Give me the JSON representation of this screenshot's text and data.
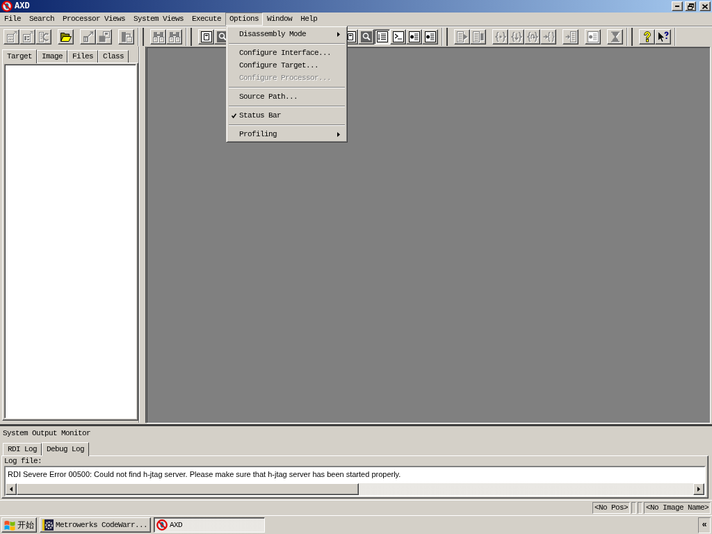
{
  "window": {
    "title": "AXD"
  },
  "menu_bar": [
    {
      "label": "File",
      "open": false
    },
    {
      "label": "Search",
      "open": false
    },
    {
      "label": "Processor Views",
      "open": false
    },
    {
      "label": "System Views",
      "open": false
    },
    {
      "label": "Execute",
      "open": false
    },
    {
      "label": "Options",
      "open": true,
      "groups": [
        [
          {
            "label": "Disassembly Mode",
            "submenu": true,
            "checked": false,
            "disabled": false
          }
        ],
        [
          {
            "label": "Configure Interface...",
            "submenu": false,
            "checked": false,
            "disabled": false
          },
          {
            "label": "Configure Target...",
            "submenu": false,
            "checked": false,
            "disabled": false
          },
          {
            "label": "Configure Processor...",
            "submenu": false,
            "checked": false,
            "disabled": true
          }
        ],
        [
          {
            "label": "Source Path...",
            "submenu": false,
            "checked": false,
            "disabled": false
          }
        ],
        [
          {
            "label": "Status Bar",
            "submenu": false,
            "checked": true,
            "disabled": false
          }
        ],
        [
          {
            "label": "Profiling",
            "submenu": true,
            "checked": false,
            "disabled": false
          }
        ]
      ]
    },
    {
      "label": "Window",
      "open": false
    },
    {
      "label": "Help",
      "open": false
    }
  ],
  "toolbars": [
    {
      "runs": [
        [
          {
            "kind": "binary",
            "disabled": true,
            "pressed": false
          },
          {
            "kind": "symbols",
            "disabled": true,
            "pressed": false
          },
          {
            "kind": "reload",
            "disabled": true,
            "pressed": false
          }
        ],
        [
          {
            "kind": "open",
            "disabled": false,
            "pressed": false
          }
        ],
        [
          {
            "kind": "load",
            "disabled": true,
            "pressed": false
          },
          {
            "kind": "save",
            "disabled": true,
            "pressed": false
          }
        ],
        [
          {
            "kind": "export",
            "disabled": true,
            "pressed": false
          }
        ]
      ]
    },
    {
      "runs": [
        [
          {
            "kind": "find",
            "disabled": true,
            "pressed": false
          },
          {
            "kind": "findnext",
            "disabled": true,
            "pressed": false
          }
        ]
      ]
    },
    {
      "runs": [
        [
          {
            "kind": "frame",
            "disabled": false,
            "pressed": false
          },
          {
            "kind": "watch",
            "disabled": false,
            "pressed": false
          }
        ],
        [
          {
            "kind": "frame",
            "disabled": false,
            "pressed": false
          },
          {
            "kind": "watch",
            "disabled": false,
            "pressed": false
          },
          {
            "kind": "list",
            "disabled": false,
            "pressed": true
          },
          {
            "kind": "console",
            "disabled": false,
            "pressed": false
          },
          {
            "kind": "bullets",
            "disabled": false,
            "pressed": false
          },
          {
            "kind": "bullets",
            "disabled": false,
            "pressed": false
          }
        ]
      ]
    },
    {
      "runs": [
        [
          {
            "kind": "run",
            "disabled": true,
            "pressed": false
          },
          {
            "kind": "stop",
            "disabled": true,
            "pressed": false
          }
        ],
        [
          {
            "kind": "stepin",
            "disabled": true,
            "pressed": false
          },
          {
            "kind": "stepover",
            "disabled": true,
            "pressed": false
          },
          {
            "kind": "stepout",
            "disabled": true,
            "pressed": false
          },
          {
            "kind": "stepto",
            "disabled": true,
            "pressed": false
          }
        ],
        [
          {
            "kind": "runto",
            "disabled": true,
            "pressed": false
          }
        ],
        [
          {
            "kind": "bullets",
            "disabled": true,
            "pressed": false
          }
        ],
        [
          {
            "kind": "wait",
            "disabled": true,
            "pressed": false
          }
        ]
      ]
    },
    {
      "runs": [
        [
          {
            "kind": "help",
            "disabled": false,
            "pressed": false
          },
          {
            "kind": "pointer",
            "disabled": false,
            "pressed": false
          }
        ]
      ]
    }
  ],
  "workspace": {
    "tabs": [
      {
        "label": "Target",
        "selected": true
      },
      {
        "label": "Image",
        "selected": false
      },
      {
        "label": "Files",
        "selected": false
      },
      {
        "label": "Class",
        "selected": false
      }
    ]
  },
  "output_monitor": {
    "title": "System Output Monitor",
    "tabs": [
      {
        "label": "RDI Log",
        "selected": false
      },
      {
        "label": "Debug Log",
        "selected": true
      }
    ],
    "log_label": "Log file:",
    "log_text": "RDI Severe Error 00500: Could not find h-jtag server. Please make sure that h-jtag server has been started properly."
  },
  "status_bar": {
    "panels": [
      "<No Pos>",
      "<No Image Name>"
    ]
  },
  "taskbar": {
    "start": "开始",
    "tasks": [
      {
        "kind": "gear",
        "label": "Metrowerks CodeWarr...",
        "selected": false
      },
      {
        "kind": "prohibition",
        "label": "AXD",
        "selected": true
      }
    ],
    "tray_button": "«"
  }
}
